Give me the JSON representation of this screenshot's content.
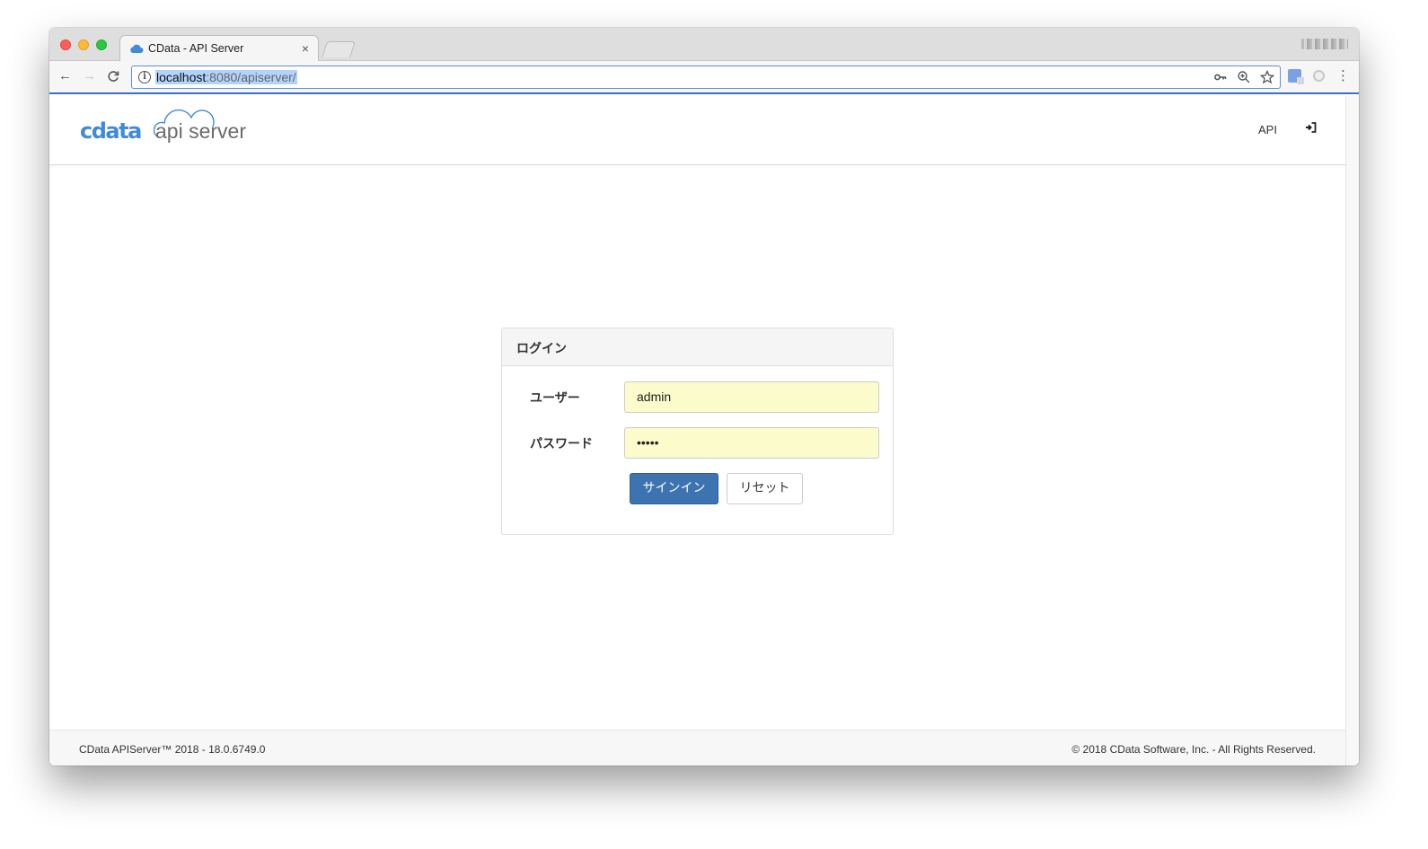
{
  "browser": {
    "tab_title": "CData - API Server",
    "tab_close": "×",
    "url_host": "localhost",
    "url_path": ":8080/apiserver/",
    "icons": {
      "back": "←",
      "forward": "→",
      "reload": "C",
      "key": "🔑",
      "zoom": "⊕",
      "star": "☆",
      "menu": "⋮"
    }
  },
  "header": {
    "logo_brand": "cdata",
    "logo_product": "api server",
    "nav_api": "API",
    "signin_icon": "⮊"
  },
  "login": {
    "title": "ログイン",
    "user_label": "ユーザー",
    "user_value": "admin",
    "password_label": "パスワード",
    "password_value": "•••••",
    "signin_button": "サインイン",
    "reset_button": "リセット"
  },
  "footer": {
    "left": "CData APIServer™ 2018 - 18.0.6749.0",
    "right": "© 2018 CData Software, Inc. - All Rights Reserved."
  },
  "colors": {
    "brand_blue": "#3f8bd9",
    "primary_button": "#3c73b0",
    "autofill_yellow": "#fbfbcb"
  }
}
